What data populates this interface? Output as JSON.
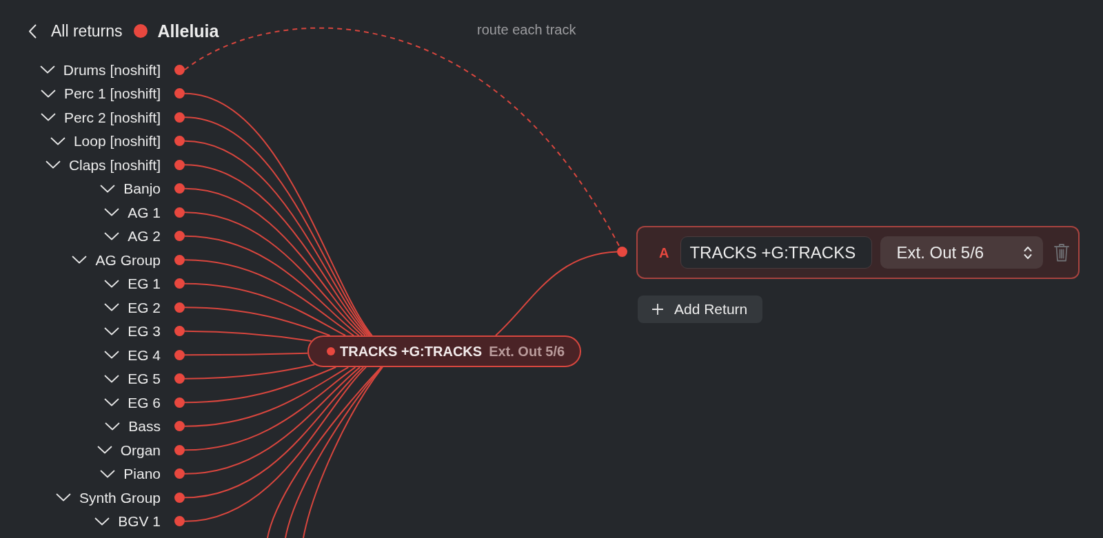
{
  "header": {
    "back_label": "All returns",
    "title": "Alleluia"
  },
  "hint": "route each track",
  "tracks": [
    {
      "name": "Drums [noshift]",
      "kind": "direct"
    },
    {
      "name": "Perc 1 [noshift]",
      "kind": "grouped"
    },
    {
      "name": "Perc 2 [noshift]",
      "kind": "grouped"
    },
    {
      "name": "Loop [noshift]",
      "kind": "grouped"
    },
    {
      "name": "Claps [noshift]",
      "kind": "grouped"
    },
    {
      "name": "Banjo",
      "kind": "grouped"
    },
    {
      "name": "AG 1",
      "kind": "grouped"
    },
    {
      "name": "AG 2",
      "kind": "grouped"
    },
    {
      "name": "AG Group",
      "kind": "grouped"
    },
    {
      "name": "EG 1",
      "kind": "grouped"
    },
    {
      "name": "EG 2",
      "kind": "grouped"
    },
    {
      "name": "EG 3",
      "kind": "grouped"
    },
    {
      "name": "EG 4",
      "kind": "grouped"
    },
    {
      "name": "EG 5",
      "kind": "grouped"
    },
    {
      "name": "EG 6",
      "kind": "grouped"
    },
    {
      "name": "Bass",
      "kind": "grouped"
    },
    {
      "name": "Organ",
      "kind": "grouped"
    },
    {
      "name": "Piano",
      "kind": "grouped"
    },
    {
      "name": "Synth Group",
      "kind": "grouped"
    },
    {
      "name": "BGV 1",
      "kind": "grouped"
    }
  ],
  "group_node": {
    "name": "TRACKS +G:TRACKS",
    "output": "Ext. Out 5/6"
  },
  "returns": [
    {
      "letter": "A",
      "name": "TRACKS +G:TRACKS",
      "output": "Ext. Out 5/6"
    }
  ],
  "add_button": "Add Return"
}
